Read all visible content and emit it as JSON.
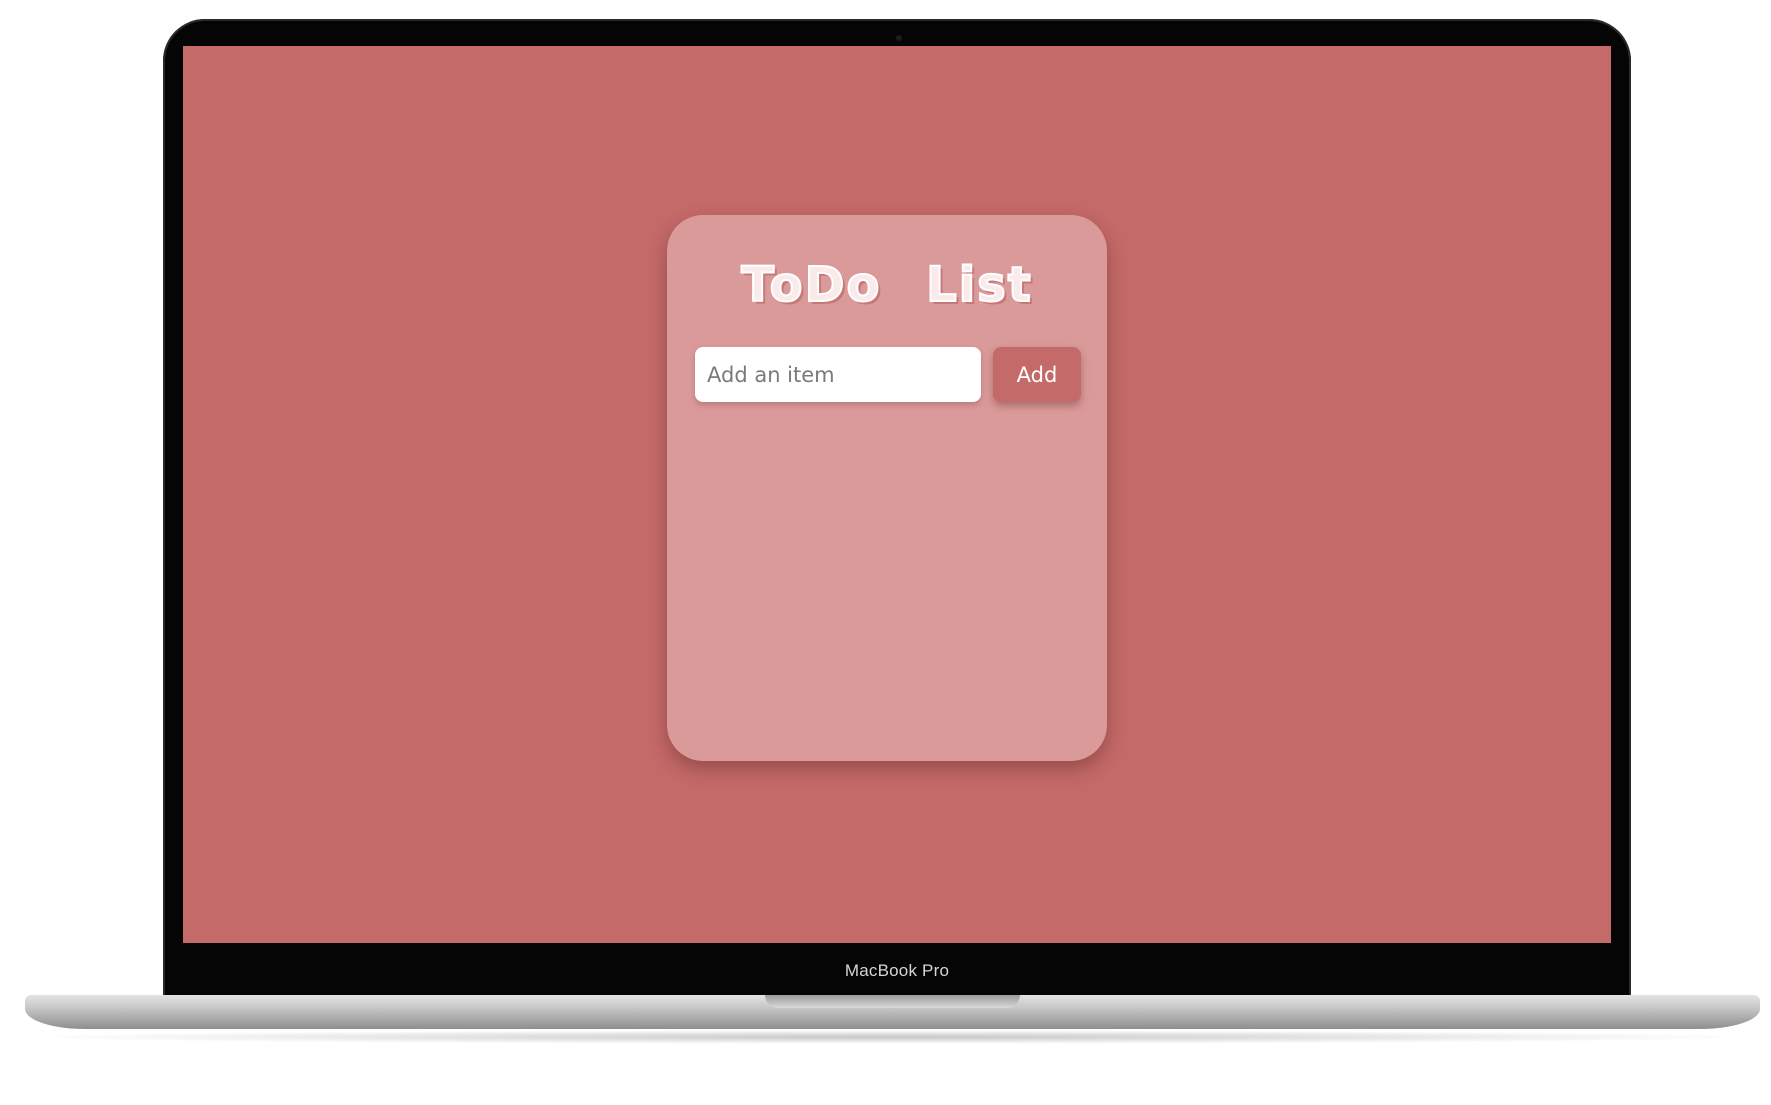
{
  "device": {
    "brand_label": "MacBook Pro"
  },
  "app": {
    "title": "ToDo List",
    "input": {
      "value": "",
      "placeholder": "Add an item"
    },
    "add_button_label": "Add",
    "items": []
  },
  "colors": {
    "background": "#c46a69",
    "card": "#da9a9a",
    "button": "#c46a69",
    "button_text": "#ffffff",
    "title": "#ffffff"
  }
}
